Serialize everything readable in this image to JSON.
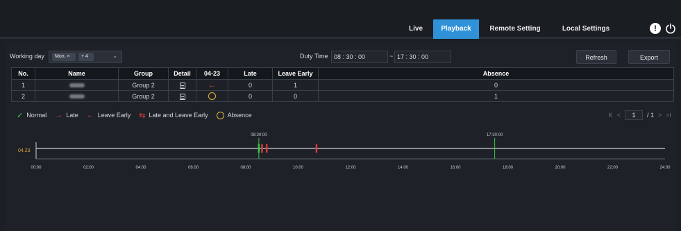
{
  "nav": {
    "items": [
      {
        "label": "Live"
      },
      {
        "label": "Playback"
      },
      {
        "label": "Remote Setting"
      },
      {
        "label": "Local Settings"
      }
    ],
    "alert_glyph": "!"
  },
  "filters": {
    "working_day_label": "Working day",
    "selected_day": "Mon.",
    "selected_day_remove": "×",
    "more_count": "+ 4",
    "duty_time_label": "Duty Time",
    "start_time": "08 : 30 : 00",
    "separator": "~",
    "end_time": "17 : 30 : 00",
    "refresh_label": "Refresh",
    "export_label": "Export"
  },
  "table": {
    "headers": [
      "No.",
      "Name",
      "Group",
      "Detail",
      "04-23",
      "Late",
      "Leave Early",
      "Absence"
    ],
    "rows": [
      {
        "no": "1",
        "group": "Group 2",
        "status": "leave-early",
        "late": "0",
        "leave_early": "1",
        "absence": "0"
      },
      {
        "no": "2",
        "group": "Group 2",
        "status": "absence",
        "late": "0",
        "leave_early": "0",
        "absence": "1"
      }
    ]
  },
  "legend": {
    "normal": "Normal",
    "late": "Late",
    "leave_early": "Leave Early",
    "late_and_leave": "Late and Leave Early",
    "absence": "Absence"
  },
  "pager": {
    "first": "K",
    "prev": "<",
    "current": "1",
    "total": "/ 1",
    "next": ">",
    "last": ">I"
  },
  "timeline": {
    "row_label": "04.23",
    "start_marker": "08:30:00",
    "end_marker": "17:30:00",
    "ticks": [
      "00:00",
      "02:00",
      "04:00",
      "06:00",
      "08:00",
      "10:00",
      "12:00",
      "14:00",
      "16:00",
      "18:00",
      "20:00",
      "22:00",
      "24:00"
    ],
    "duty_start_hour": 8.5,
    "duty_end_hour": 17.5,
    "events": [
      {
        "hour": 8.5,
        "type": "normal"
      },
      {
        "hour": 8.62,
        "type": "late"
      },
      {
        "hour": 8.8,
        "type": "late"
      },
      {
        "hour": 10.7,
        "type": "late"
      }
    ]
  },
  "colors": {
    "accent": "#2f92d8",
    "normal": "#3bc94a",
    "late": "#e03a3a",
    "absence": "#e0b73a"
  }
}
